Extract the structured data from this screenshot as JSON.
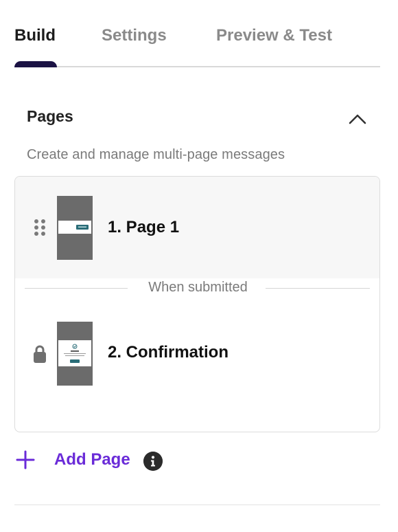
{
  "tabs": [
    {
      "label": "Build",
      "active": true
    },
    {
      "label": "Settings",
      "active": false
    },
    {
      "label": "Preview & Test",
      "active": false
    }
  ],
  "pages_section": {
    "title": "Pages",
    "subtitle": "Create and manage multi-page messages",
    "collapse_icon": "chevron-up-icon",
    "pages": [
      {
        "name": "1. Page 1",
        "icon": "drag-handle-icon",
        "thumbnail": "page-1-thumbnail"
      },
      {
        "name": "2. Confirmation",
        "icon": "lock-icon",
        "thumbnail": "confirmation-thumbnail"
      }
    ],
    "divider_text": "When submitted",
    "add_page": {
      "label": "Add Page",
      "icon": "plus-icon",
      "info_icon": "info-icon"
    }
  },
  "colors": {
    "accent": "#6a2bd8",
    "tab_indicator": "#1b1244",
    "thumb_bg": "#6b6b6b",
    "teal_button": "#2a6d78"
  }
}
